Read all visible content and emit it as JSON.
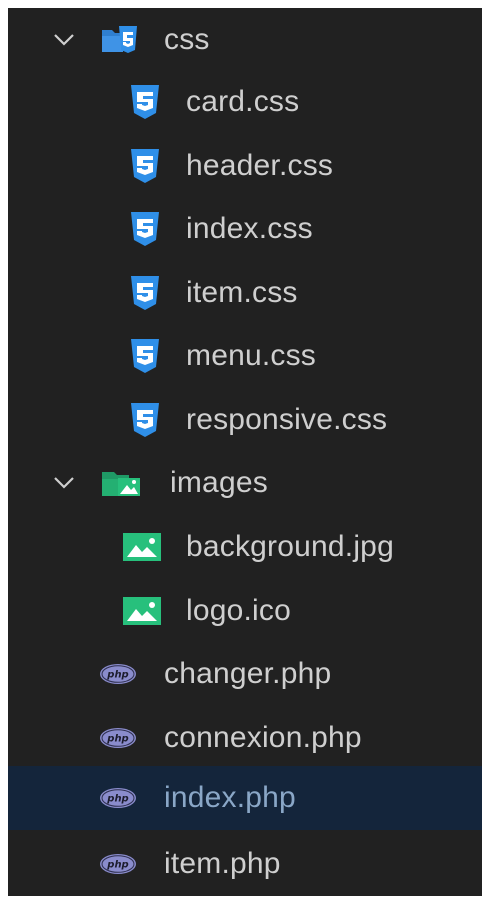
{
  "explorer": {
    "colors": {
      "background": "#212121",
      "text": "#cfcfcf",
      "selected_background": "#14253b",
      "css_icon": "#2f8fe8",
      "image_icon": "#26b37a",
      "php_icon": "#8a8ccc"
    },
    "folders": [
      {
        "name": "css",
        "expanded": true,
        "icon": "css-folder-icon",
        "files": [
          {
            "name": "card.css",
            "icon": "css-file-icon"
          },
          {
            "name": "header.css",
            "icon": "css-file-icon"
          },
          {
            "name": "index.css",
            "icon": "css-file-icon"
          },
          {
            "name": "item.css",
            "icon": "css-file-icon"
          },
          {
            "name": "menu.css",
            "icon": "css-file-icon"
          },
          {
            "name": "responsive.css",
            "icon": "css-file-icon"
          }
        ]
      },
      {
        "name": "images",
        "expanded": true,
        "icon": "images-folder-icon",
        "files": [
          {
            "name": "background.jpg",
            "icon": "image-file-icon"
          },
          {
            "name": "logo.ico",
            "icon": "image-file-icon"
          }
        ]
      }
    ],
    "files": [
      {
        "name": "changer.php",
        "icon": "php-file-icon",
        "selected": false
      },
      {
        "name": "connexion.php",
        "icon": "php-file-icon",
        "selected": false
      },
      {
        "name": "index.php",
        "icon": "php-file-icon",
        "selected": true
      },
      {
        "name": "item.php",
        "icon": "php-file-icon",
        "selected": false
      }
    ]
  }
}
